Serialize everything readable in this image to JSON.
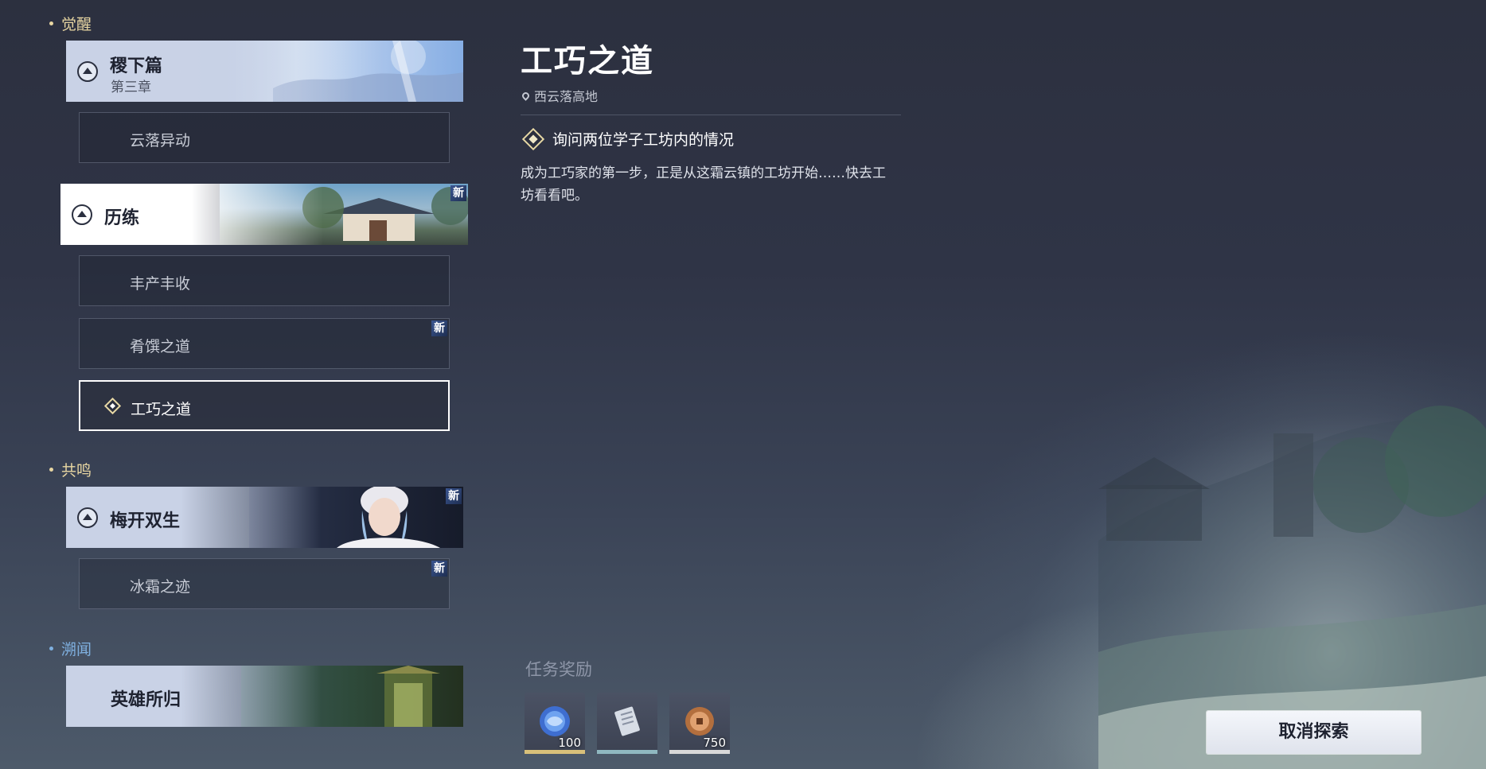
{
  "sections": {
    "awaken": "觉醒",
    "resonance": "共鸣",
    "lore": "溯闻"
  },
  "chapters": {
    "c1": {
      "title": "稷下篇",
      "subtitle": "第三章"
    },
    "c2": {
      "title": "历练",
      "badge": "新"
    },
    "c3": {
      "title": "梅开双生",
      "badge": "新"
    },
    "c4": {
      "title": "英雄所归"
    }
  },
  "quests": {
    "q1": {
      "label": "云落异动"
    },
    "q2": {
      "label": "丰产丰收"
    },
    "q3": {
      "label": "肴馔之道",
      "badge": "新"
    },
    "q4": {
      "label": "工巧之道"
    },
    "q5": {
      "label": "冰霜之迹",
      "badge": "新"
    }
  },
  "detail": {
    "title": "工巧之道",
    "location": "西云落高地",
    "objective": "询问两位学子工坊内的情况",
    "description": "成为工巧家的第一步，正是从这霜云镇的工坊开始……快去工坊看看吧。"
  },
  "rewards": {
    "title": "任务奖励",
    "items": [
      {
        "icon": "blue-orb-icon",
        "qty": "100",
        "color": "#d8c07a"
      },
      {
        "icon": "scroll-icon",
        "qty": "",
        "color": "#8fb8c0"
      },
      {
        "icon": "bronze-coin-icon",
        "qty": "750",
        "color": "#d8d8d8"
      }
    ]
  },
  "buttons": {
    "cancel": "取消探索"
  }
}
